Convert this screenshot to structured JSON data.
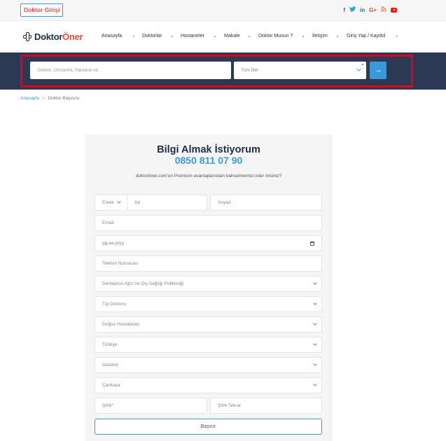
{
  "topbar": {
    "doctor_login": "Doktor Girişi",
    "social_icons": [
      "facebook-icon",
      "twitter-icon",
      "linkedin-icon",
      "google-plus-icon",
      "rss-icon",
      "youtube-icon"
    ],
    "social_glyphs": {
      "facebook": "f",
      "twitter": "🐦",
      "linkedin": "in",
      "googleplus": "G+",
      "rss": "))"
    }
  },
  "logo": {
    "part1": "Doktor",
    "part2": "Öner"
  },
  "nav": {
    "items": [
      "Anasayfa",
      "Doktorlar",
      "Hastaneler",
      "Makale",
      "Doktor Musun ?",
      "İletişim",
      "Giriş Yap / Kaydol"
    ]
  },
  "search": {
    "placeholder": "Doktor, Uzmanlık, Hastane vb.",
    "city_value": "Tüm İller",
    "go_glyph": "→"
  },
  "breadcrumb": {
    "home": "Anasayfa",
    "separator": "›",
    "current": "Doktor Başvuru"
  },
  "form": {
    "title": "Bilgi Almak İstiyorum",
    "phone": "0850 811 07 90",
    "description": "doktoröner.com'un Premium avantajlarından bahsetmemizi ister misiniz?",
    "gender": "Erkek",
    "first_name_placeholder": "Ad",
    "last_name_placeholder": "Soyad",
    "email_placeholder": "Email",
    "date_placeholder": "gg.aa.yyyy",
    "phone_placeholder": "Telefon Numarası",
    "clinic": "Dentapros Ağız Ve Diş Sağlığı Polikliniği",
    "title_select": "Tıp Doktoru",
    "specialty": "Göğüs Hastalıkları",
    "country": "Türkiye",
    "city": "İstanbul",
    "district": "Çankaya",
    "password_placeholder": "Şifre*",
    "password_repeat_placeholder": "Şifre Tekrar",
    "submit": "Başvur"
  },
  "colors": {
    "brand_navy": "#1f2d4d",
    "accent_blue": "#3a9ad9",
    "accent_red": "#e74c3c",
    "highlight_frame": "#e3001b"
  }
}
